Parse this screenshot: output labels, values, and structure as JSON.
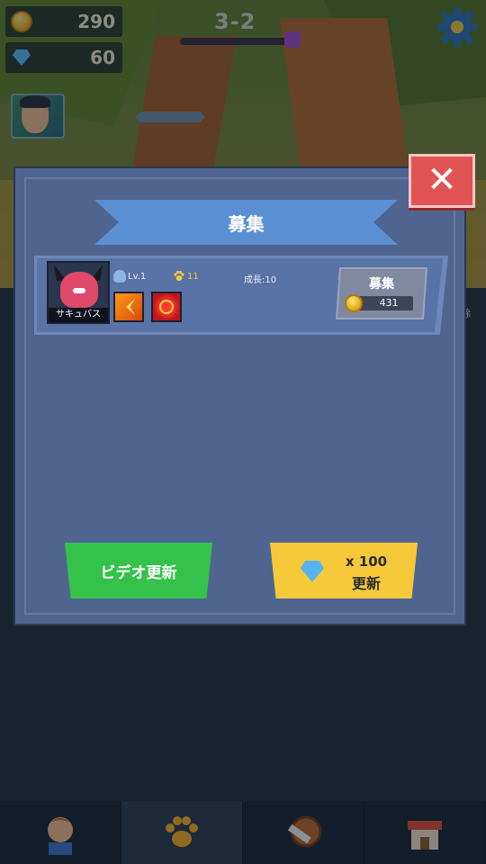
{
  "hud": {
    "coins": "290",
    "gems": "60",
    "stage": "3-2",
    "icons": [
      "coin-icon",
      "gem-icon",
      "gear-icon",
      "boss-icon"
    ]
  },
  "background": {
    "side_label": "除"
  },
  "dialog": {
    "title": "募集",
    "close_label": "✕",
    "card": {
      "name": "サキュバス",
      "level": "Lv.1",
      "paw_value": "11",
      "growth": "成長:10",
      "recruit_label": "募集",
      "recruit_price": "431",
      "skills": [
        "claw-skill-icon",
        "target-skill-icon"
      ]
    },
    "video_refresh_label": "ビデオ更新",
    "gem_refresh_cost": "x 100",
    "gem_refresh_label": "更新"
  },
  "nav": {
    "tabs": [
      "hero-tab",
      "pets-tab",
      "equipment-tab",
      "shop-tab"
    ],
    "active": "pets-tab"
  },
  "colors": {
    "dialog_bg": "#4f6590",
    "ribbon": "#5b8fd4",
    "close": "#e25454",
    "video_button": "#34c24a",
    "gem_button": "#f6c93a"
  }
}
